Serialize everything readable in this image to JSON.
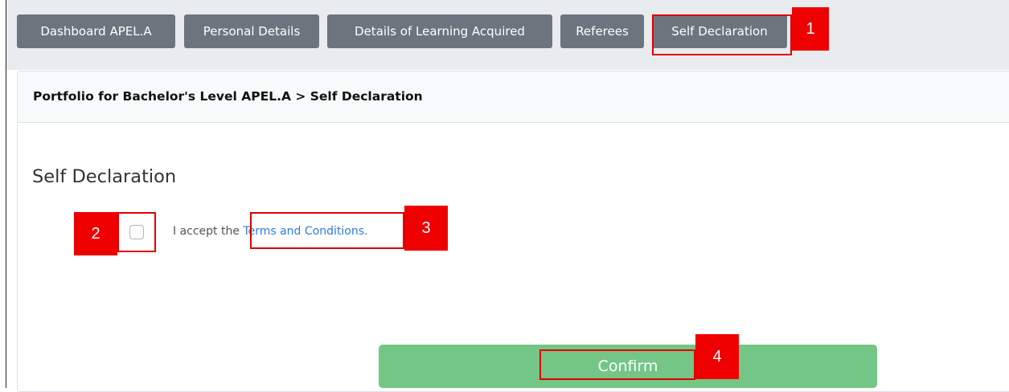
{
  "tabs": [
    {
      "label": "Dashboard APEL.A"
    },
    {
      "label": "Personal Details"
    },
    {
      "label": "Details of Learning Acquired"
    },
    {
      "label": "Referees"
    },
    {
      "label": "Self Declaration",
      "active": true
    }
  ],
  "breadcrumb": "Portfolio for Bachelor's Level APEL.A > Self Declaration",
  "section_title": "Self Declaration",
  "terms": {
    "checked": false,
    "prefix": "I accept the ",
    "link": "Terms and Conditions."
  },
  "confirm_label": "Confirm",
  "markers": [
    "1",
    "2",
    "3",
    "4"
  ],
  "colors": {
    "tab_bg": "#6c757d",
    "confirm_bg": "#74c687",
    "link": "#2c7be5",
    "annotation": "#ee0000"
  }
}
